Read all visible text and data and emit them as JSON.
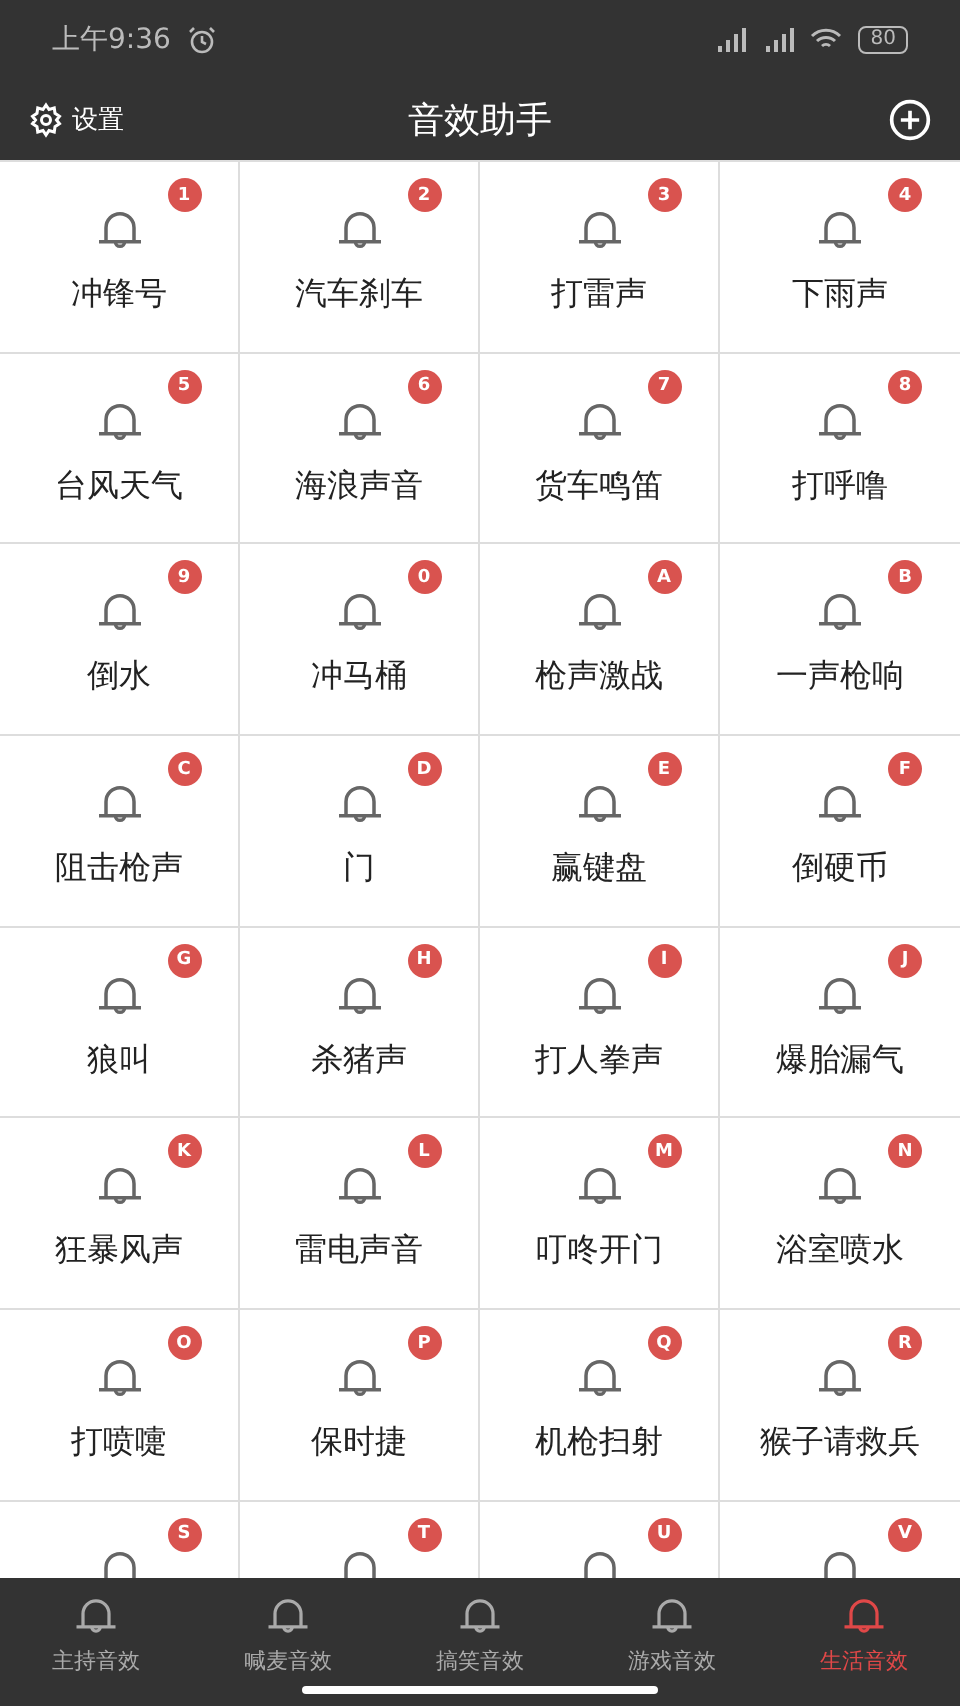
{
  "status_bar": {
    "time": "上午9:36",
    "battery": "80"
  },
  "header": {
    "settings_label": "设置",
    "title": "音效助手"
  },
  "sounds": [
    {
      "badge": "1",
      "label": "冲锋号"
    },
    {
      "badge": "2",
      "label": "汽车刹车"
    },
    {
      "badge": "3",
      "label": "打雷声"
    },
    {
      "badge": "4",
      "label": "下雨声"
    },
    {
      "badge": "5",
      "label": "台风天气"
    },
    {
      "badge": "6",
      "label": "海浪声音"
    },
    {
      "badge": "7",
      "label": "货车鸣笛"
    },
    {
      "badge": "8",
      "label": "打呼噜"
    },
    {
      "badge": "9",
      "label": "倒水"
    },
    {
      "badge": "0",
      "label": "冲马桶"
    },
    {
      "badge": "A",
      "label": "枪声激战"
    },
    {
      "badge": "B",
      "label": "一声枪响"
    },
    {
      "badge": "C",
      "label": "阻击枪声"
    },
    {
      "badge": "D",
      "label": "门"
    },
    {
      "badge": "E",
      "label": "赢键盘"
    },
    {
      "badge": "F",
      "label": "倒硬币"
    },
    {
      "badge": "G",
      "label": "狼叫"
    },
    {
      "badge": "H",
      "label": "杀猪声"
    },
    {
      "badge": "I",
      "label": "打人拳声"
    },
    {
      "badge": "J",
      "label": "爆胎漏气"
    },
    {
      "badge": "K",
      "label": "狂暴风声"
    },
    {
      "badge": "L",
      "label": "雷电声音"
    },
    {
      "badge": "M",
      "label": "叮咚开门"
    },
    {
      "badge": "N",
      "label": "浴室喷水"
    },
    {
      "badge": "O",
      "label": "打喷嚏"
    },
    {
      "badge": "P",
      "label": "保时捷"
    },
    {
      "badge": "Q",
      "label": "机枪扫射"
    },
    {
      "badge": "R",
      "label": "猴子请救兵"
    },
    {
      "badge": "S"
    },
    {
      "badge": "T"
    },
    {
      "badge": "U"
    },
    {
      "badge": "V"
    }
  ],
  "tabs": [
    {
      "label": "主持音效",
      "selected": false
    },
    {
      "label": "喊麦音效",
      "selected": false
    },
    {
      "label": "搞笑音效",
      "selected": false
    },
    {
      "label": "游戏音效",
      "selected": false
    },
    {
      "label": "生活音效",
      "selected": true
    }
  ]
}
